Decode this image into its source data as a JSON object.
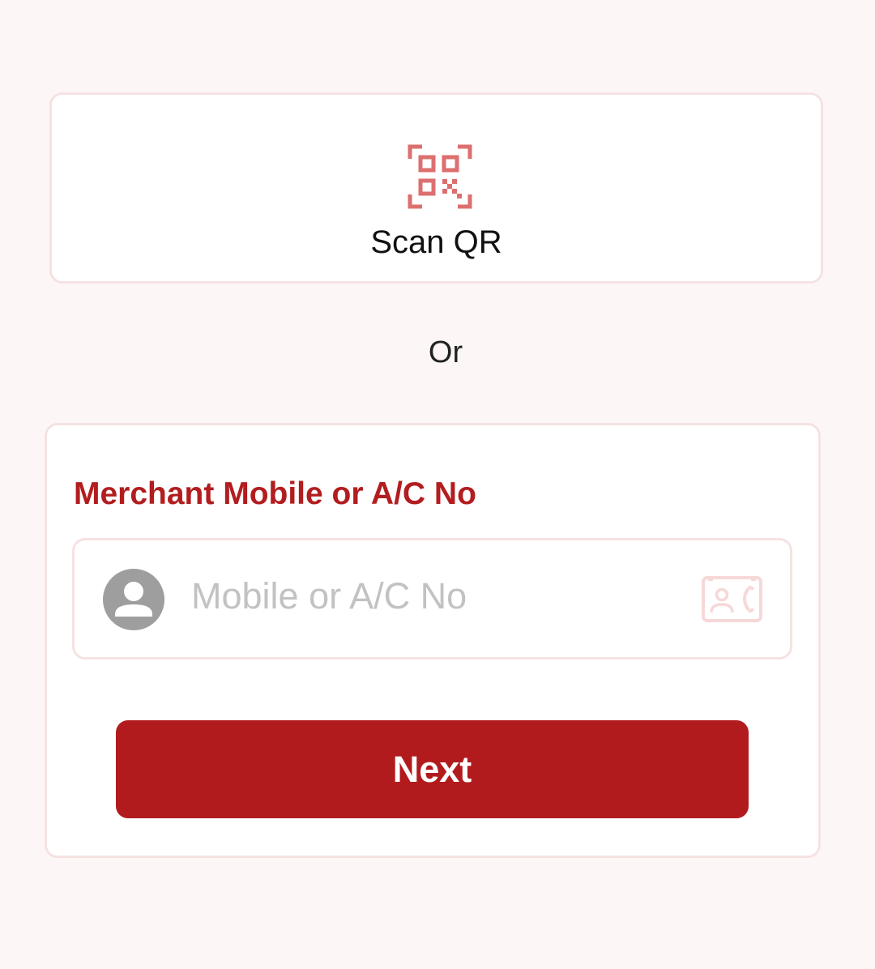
{
  "scan": {
    "label": "Scan QR",
    "icon": "qr-code-scan-icon"
  },
  "separator": {
    "label": "Or"
  },
  "merchant_form": {
    "field_label": "Merchant Mobile or A/C No",
    "input": {
      "placeholder": "Mobile or A/C No",
      "value": ""
    },
    "left_icon": "person-avatar-icon",
    "right_icon": "contacts-book-icon",
    "next_label": "Next"
  },
  "colors": {
    "background": "#fdf6f6",
    "accent": "#b21b1e",
    "card_border": "#f6e2e2",
    "qr_icon": "#dd6f6f",
    "placeholder": "#c2c2c2",
    "avatar": "#9e9e9e"
  }
}
